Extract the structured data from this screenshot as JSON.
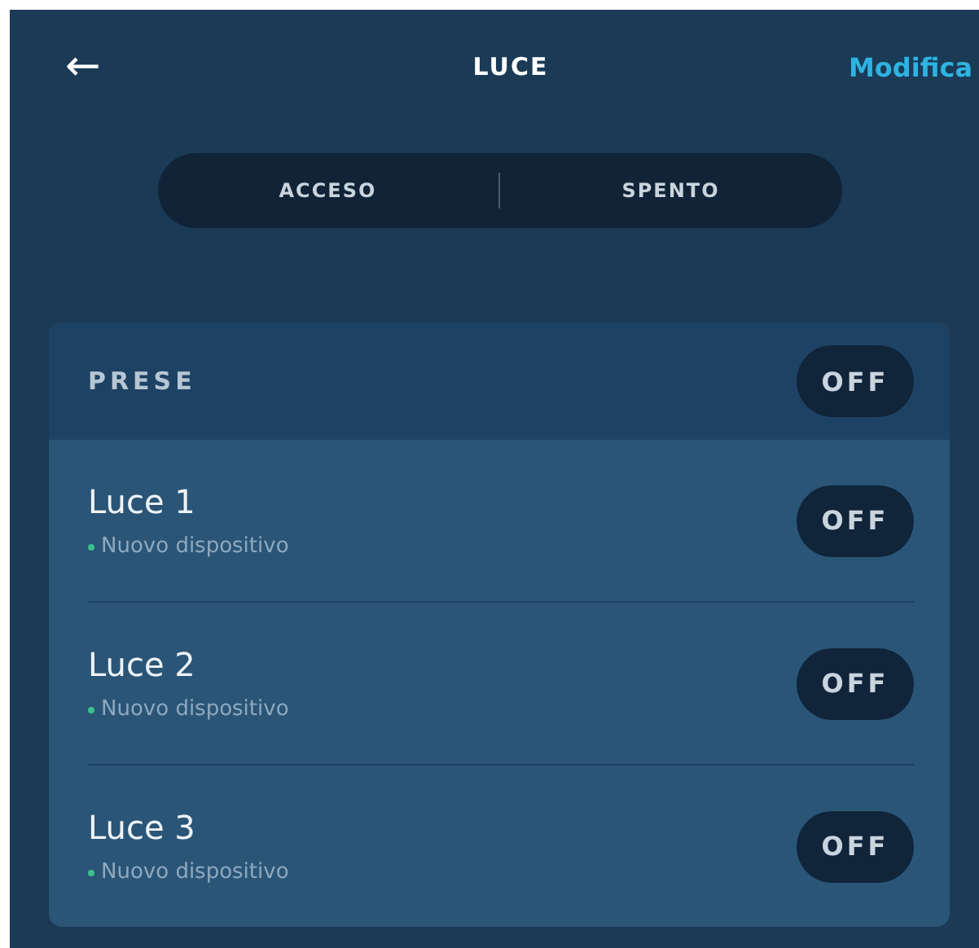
{
  "header": {
    "back": "←",
    "title": "LUCE",
    "action": "Modifica"
  },
  "segments": [
    {
      "label": "ACCESO"
    },
    {
      "label": "SPENTO"
    }
  ],
  "group": {
    "title": "PRESE",
    "toggle": "OFF",
    "devices": [
      {
        "name": "Luce 1",
        "status": "Nuovo dispositivo",
        "toggle": "OFF"
      },
      {
        "name": "Luce 2",
        "status": "Nuovo dispositivo",
        "toggle": "OFF"
      },
      {
        "name": "Luce 3",
        "status": "Nuovo dispositivo",
        "toggle": "OFF"
      }
    ]
  }
}
